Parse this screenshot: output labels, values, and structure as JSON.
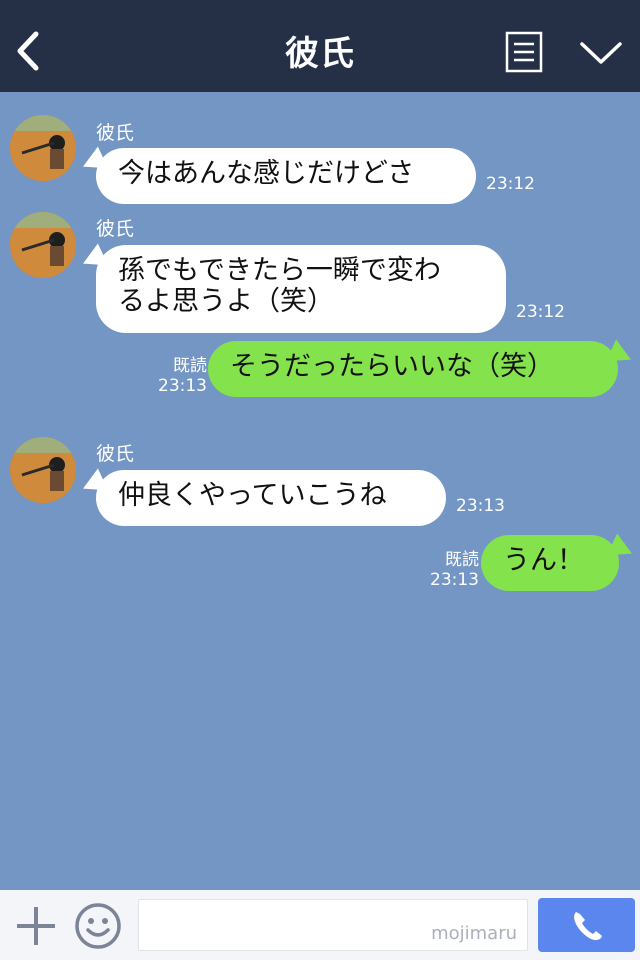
{
  "header": {
    "title": "彼氏"
  },
  "messages": [
    {
      "sender": "彼氏",
      "text": "今はあんな感じだけどさ",
      "time": "23:12"
    },
    {
      "sender": "彼氏",
      "line1": "孫でもできたら一瞬で変わ",
      "line2": "るよ思うよ（笑）",
      "time": "23:12"
    },
    {
      "read": "既読",
      "text": "そうだったらいいな（笑）",
      "time": "23:13"
    },
    {
      "sender": "彼氏",
      "text": "仲良くやっていこうね",
      "time": "23:13"
    },
    {
      "read": "既読",
      "text": "うん！",
      "time": "23:13"
    }
  ],
  "footer": {
    "input_value": "",
    "watermark": "mojimaru"
  },
  "colors": {
    "header_bg": "#252f46",
    "chat_bg": "#7496c4",
    "incoming_bubble": "#ffffff",
    "outgoing_bubble": "#84e24c",
    "call_button": "#5b86ee"
  },
  "icons": [
    "back-chevron-icon",
    "menu-list-icon",
    "chevron-down-icon",
    "plus-icon",
    "emoji-icon",
    "phone-icon"
  ]
}
